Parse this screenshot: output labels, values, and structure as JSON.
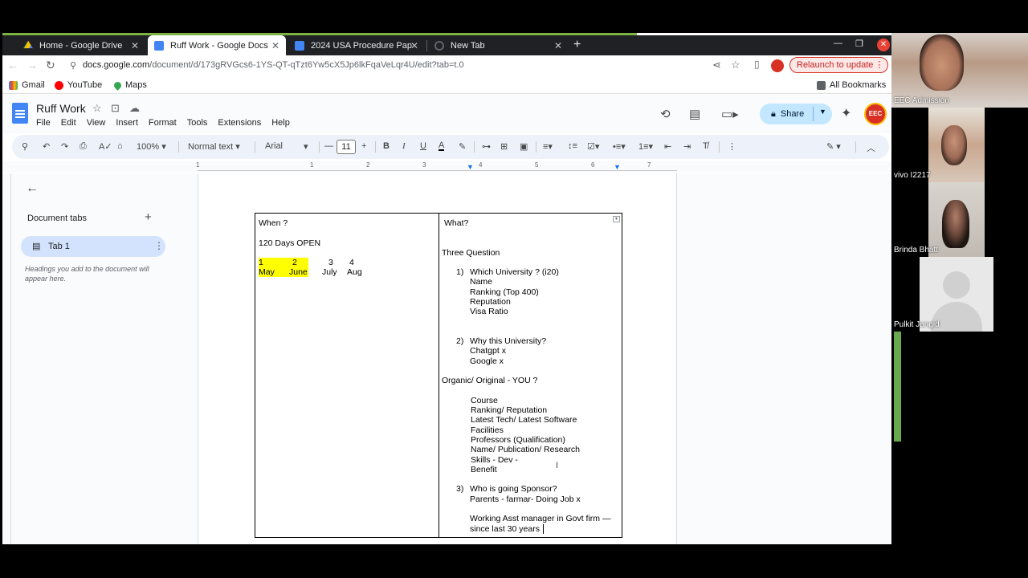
{
  "browser": {
    "tabs": [
      {
        "title": "Home - Google Drive",
        "active": false
      },
      {
        "title": "Ruff Work - Google Docs",
        "active": true
      },
      {
        "title": "2024 USA Procedure Pap",
        "active": false
      },
      {
        "title": "New Tab",
        "active": false
      }
    ],
    "url_host": "docs.google.com",
    "url_path": "/document/d/173gRVGcs6-1YS-QT-qTzt6Yw5cX5Jp6lkFqaVeLqr4U/edit?tab=t.0",
    "relaunch_label": "Relaunch to update",
    "bookmarks": [
      "Gmail",
      "YouTube",
      "Maps"
    ],
    "all_bookmarks_label": "All Bookmarks"
  },
  "docs": {
    "title": "Ruff Work",
    "menu": [
      "File",
      "Edit",
      "View",
      "Insert",
      "Format",
      "Tools",
      "Extensions",
      "Help"
    ],
    "share_label": "Share",
    "toolbar": {
      "zoom": "100%",
      "style": "Normal text",
      "font": "Arial",
      "font_size": "11"
    },
    "ruler_numbers": [
      "1",
      "1",
      "2",
      "3",
      "4",
      "5",
      "6",
      "7"
    ],
    "sidebar": {
      "doc_tabs_label": "Document tabs",
      "tab1_label": "Tab 1",
      "hint": "Headings you add to the document will appear here."
    },
    "table": {
      "left": {
        "header": "When ?",
        "line1": "120 Days OPEN",
        "nums": [
          "1",
          "2",
          "3",
          "4"
        ],
        "months": [
          "May",
          "June",
          "July",
          "Aug"
        ]
      },
      "right": {
        "header": "What?",
        "three_question": "Three Question",
        "q1_num": "1)",
        "q1": "Which University ? (i20)",
        "q1_items": [
          "Name",
          "Ranking (Top 400)",
          "Reputation",
          "Visa Ratio"
        ],
        "q2_num": "2)",
        "q2": "Why this University?",
        "q2_items": [
          "Chatgpt x",
          "Google x"
        ],
        "organic": "Organic/ Original - YOU ?",
        "organic_items": [
          "Course",
          "Ranking/ Reputation",
          "Latest Tech/ Latest Software",
          "Facilities",
          "Professors (Qualification)",
          "Name/ Publication/ Research",
          "Skills - Dev -",
          "Benefit"
        ],
        "q3_num": "3)",
        "q3": "Who is going Sponsor?",
        "q3_line": "Parents - farmar- Doing Job x",
        "working1": "Working Asst manager in Govt firm —",
        "working2": "since last 30 years"
      }
    }
  },
  "video_call": {
    "participants": [
      "EEC Admission",
      "vivo I2217",
      "Brinda Bhatt",
      "Pulkit Jangid"
    ]
  },
  "colors": {
    "tabstrip": "#202124",
    "docs_blue": "#4285f4",
    "share_bg": "#c2e7ff",
    "highlight": "#ffff00"
  }
}
